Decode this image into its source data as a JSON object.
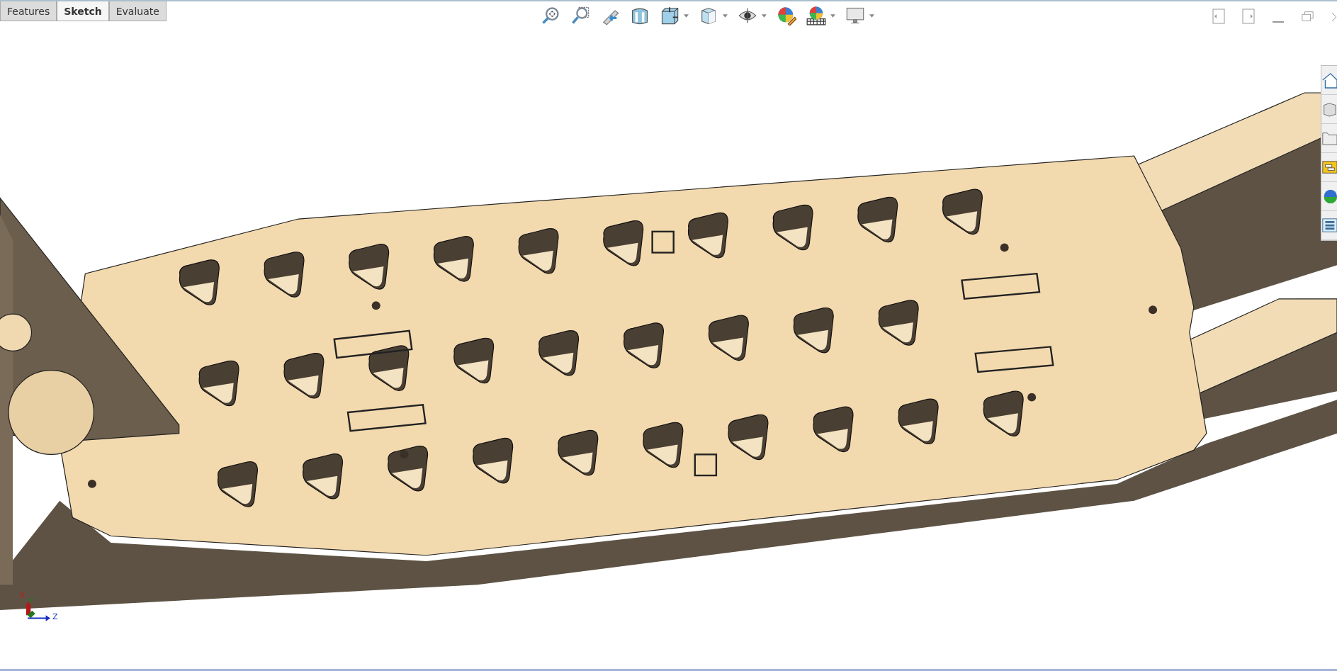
{
  "tabs": [
    {
      "label": "Features",
      "selected": false
    },
    {
      "label": "Sketch",
      "selected": true
    },
    {
      "label": "Evaluate",
      "selected": false
    }
  ],
  "triad": {
    "x_label": "X",
    "y_label": "Y",
    "z_label": "Z"
  }
}
